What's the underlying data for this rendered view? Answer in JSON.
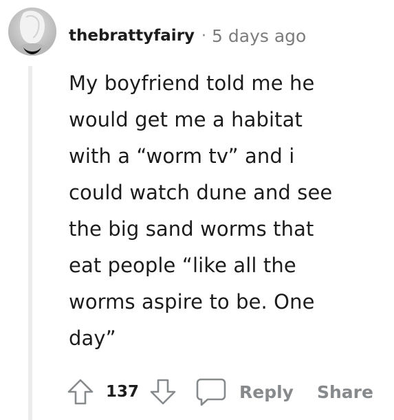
{
  "comment": {
    "author": "thebrattyfairy",
    "separator": "·",
    "timestamp": "5 days ago",
    "body": "My boyfriend told me he\nwould get me a habitat\nwith a “worm tv” and i\ncould watch dune and see\nthe big sand worms that\neat people “like all the\nworms aspire to be. One\nday”",
    "score": "137",
    "actions": {
      "reply_label": "Reply",
      "share_label": "Share"
    }
  },
  "icons": {
    "upvote": "upvote-arrow-icon",
    "downvote": "downvote-arrow-icon",
    "reply": "speech-bubble-icon"
  },
  "colors": {
    "text": "#1c1c1c",
    "muted": "#7c7c7c",
    "action": "#878a8c",
    "thread_line": "#ececec"
  }
}
